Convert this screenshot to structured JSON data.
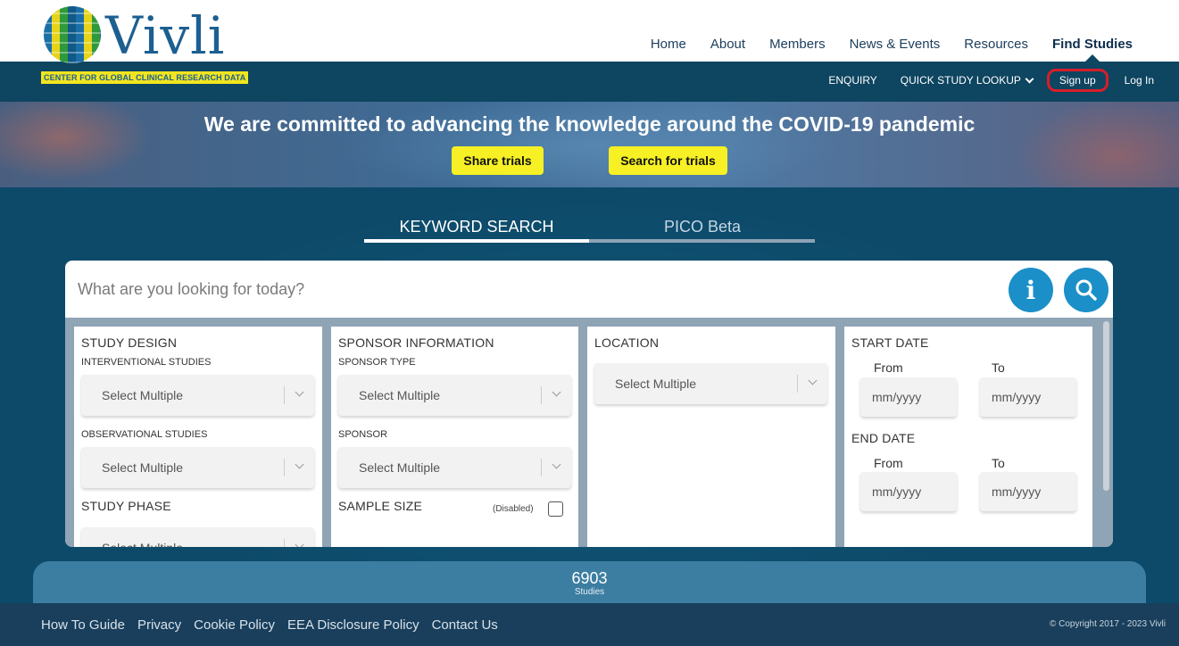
{
  "logo": {
    "wordmark": "Vivli",
    "tagline": "CENTER FOR GLOBAL CLINICAL RESEARCH DATA"
  },
  "main_nav": [
    "Home",
    "About",
    "Members",
    "News & Events",
    "Resources",
    "Find Studies"
  ],
  "main_nav_active": "Find Studies",
  "sub_nav": {
    "enquiry": "ENQUIRY",
    "quick_lookup": "QUICK STUDY LOOKUP",
    "sign_up": "Sign up",
    "log_in": "Log In"
  },
  "banner": {
    "title": "We are committed to advancing the knowledge around the COVID-19 pandemic",
    "share_button": "Share trials",
    "search_button": "Search for trials"
  },
  "tabs": {
    "keyword": "KEYWORD SEARCH",
    "pico": "PICO Beta",
    "active": "KEYWORD SEARCH"
  },
  "search": {
    "placeholder": "What are you looking for today?",
    "info_icon": "i"
  },
  "filters": {
    "study_design": "STUDY DESIGN",
    "interventional": "INTERVENTIONAL STUDIES",
    "observational": "OBSERVATIONAL STUDIES",
    "study_phase": "STUDY PHASE",
    "sponsor_information": "SPONSOR INFORMATION",
    "sponsor_type": "SPONSOR TYPE",
    "sponsor": "SPONSOR",
    "sample_size": "SAMPLE SIZE",
    "sample_size_state": "(Disabled)",
    "location": "LOCATION",
    "start_date": "START DATE",
    "end_date": "END DATE",
    "from": "From",
    "to": "To",
    "select_placeholder": "Select Multiple",
    "date_placeholder": "mm/yyyy"
  },
  "counter": {
    "value": "6903",
    "label": "Studies"
  },
  "footer": {
    "links": [
      "How To Guide",
      "Privacy",
      "Cookie Policy",
      "EEA Disclosure Policy",
      "Contact Us"
    ],
    "copyright": "© Copyright 2017 - 2023 Vivli"
  },
  "colors": {
    "brand_navy": "#0e4560",
    "accent_yellow": "#f6f024",
    "search_blue": "#1b8fc8",
    "highlight_red": "#d81e2a"
  }
}
